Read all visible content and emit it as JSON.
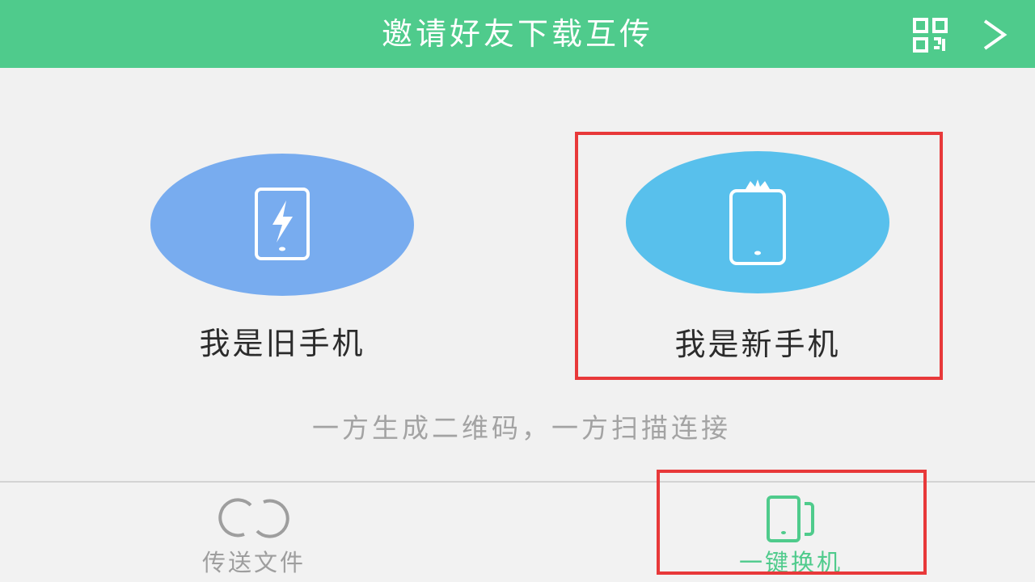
{
  "header": {
    "title": "邀请好友下载互传",
    "qr_icon": "qr-code-icon",
    "arrow_icon": "chevron-right-icon",
    "background_color": "#4fcb8c"
  },
  "roles": {
    "old_phone": {
      "label": "我是旧手机",
      "icon": "phone-lightning-icon",
      "circle_color": "#78acef"
    },
    "new_phone": {
      "label": "我是新手机",
      "icon": "phone-crown-icon",
      "circle_color": "#58c0ec"
    }
  },
  "hint": "一方生成二维码，一方扫描连接",
  "tabs": [
    {
      "label": "传送文件",
      "icon": "link-rings-icon",
      "active": false
    },
    {
      "label": "一键换机",
      "icon": "phone-switch-icon",
      "active": true
    }
  ],
  "colors": {
    "accent": "#4fcb8c",
    "highlight_border": "#e8393a",
    "hint_text": "#a3a3a3"
  }
}
